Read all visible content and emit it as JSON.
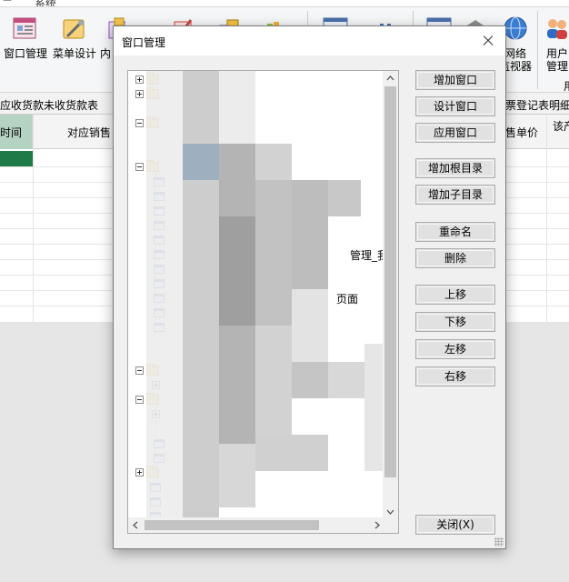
{
  "app": {
    "menubar": {
      "left_glyph": "二",
      "item": "系统"
    },
    "ribbon": {
      "buttons": [
        {
          "label": "窗口管理",
          "icon": "window-manager-icon"
        },
        {
          "label": "菜单设计",
          "icon": "menu-design-icon"
        },
        {
          "label": "内",
          "icon": "content-icon"
        },
        {
          "label": "",
          "icon": "edit-icon"
        },
        {
          "label": "",
          "icon": "tools-icon"
        },
        {
          "label": "",
          "icon": "books-icon"
        },
        {
          "label": "",
          "icon": "form-icon"
        },
        {
          "label": "",
          "icon": "chart-icon"
        },
        {
          "label": "",
          "icon": "list-icon"
        },
        {
          "label": "",
          "icon": "stack-icon"
        },
        {
          "label": "网络\n监视器",
          "icon": "globe-icon"
        },
        {
          "label": "用户\n管理",
          "icon": "users-icon"
        }
      ],
      "group_label_right": "用"
    },
    "sheet_tabs": {
      "left": "应收货款未收货款表",
      "right": "票登记表明细表"
    },
    "grid_headers": {
      "col0": "时间",
      "col1": "对应销售",
      "col2": "售单价",
      "col3": "该产"
    }
  },
  "dialog": {
    "title": "窗口管理",
    "tree_fragments": [
      "管理_我",
      "页面"
    ],
    "buttons": {
      "add_window": "增加窗口",
      "design_window": "设计窗口",
      "apply_window": "应用窗口",
      "add_root": "增加根目录",
      "add_child": "增加子目录",
      "rename": "重命名",
      "delete": "删除",
      "move_up": "上移",
      "move_down": "下移",
      "move_left": "左移",
      "move_right": "右移",
      "close": "关闭(X)"
    }
  }
}
